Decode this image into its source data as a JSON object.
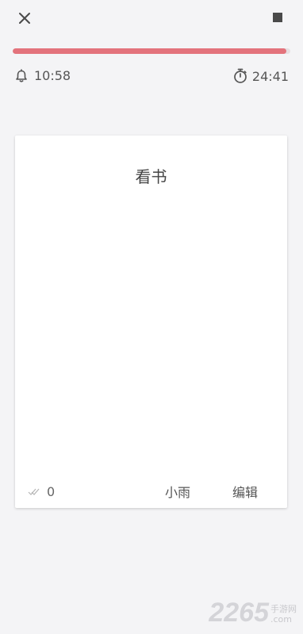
{
  "toolbar": {
    "close_icon": "close-icon",
    "stop_icon": "stop-icon"
  },
  "progress": {
    "fraction": 0.985,
    "fill_color": "#e3737c",
    "track_color": "#e7dfe2"
  },
  "alarm": {
    "icon": "bell-icon",
    "time": "10:58"
  },
  "timer": {
    "icon": "stopwatch-icon",
    "time": "24:41"
  },
  "card": {
    "title": "看书",
    "check_icon": "double-check-icon",
    "check_count": "0",
    "weather": "小雨",
    "edit_label": "编辑"
  },
  "watermark": {
    "number": "2265",
    "site_name": "手游网",
    "domain": ".com"
  }
}
